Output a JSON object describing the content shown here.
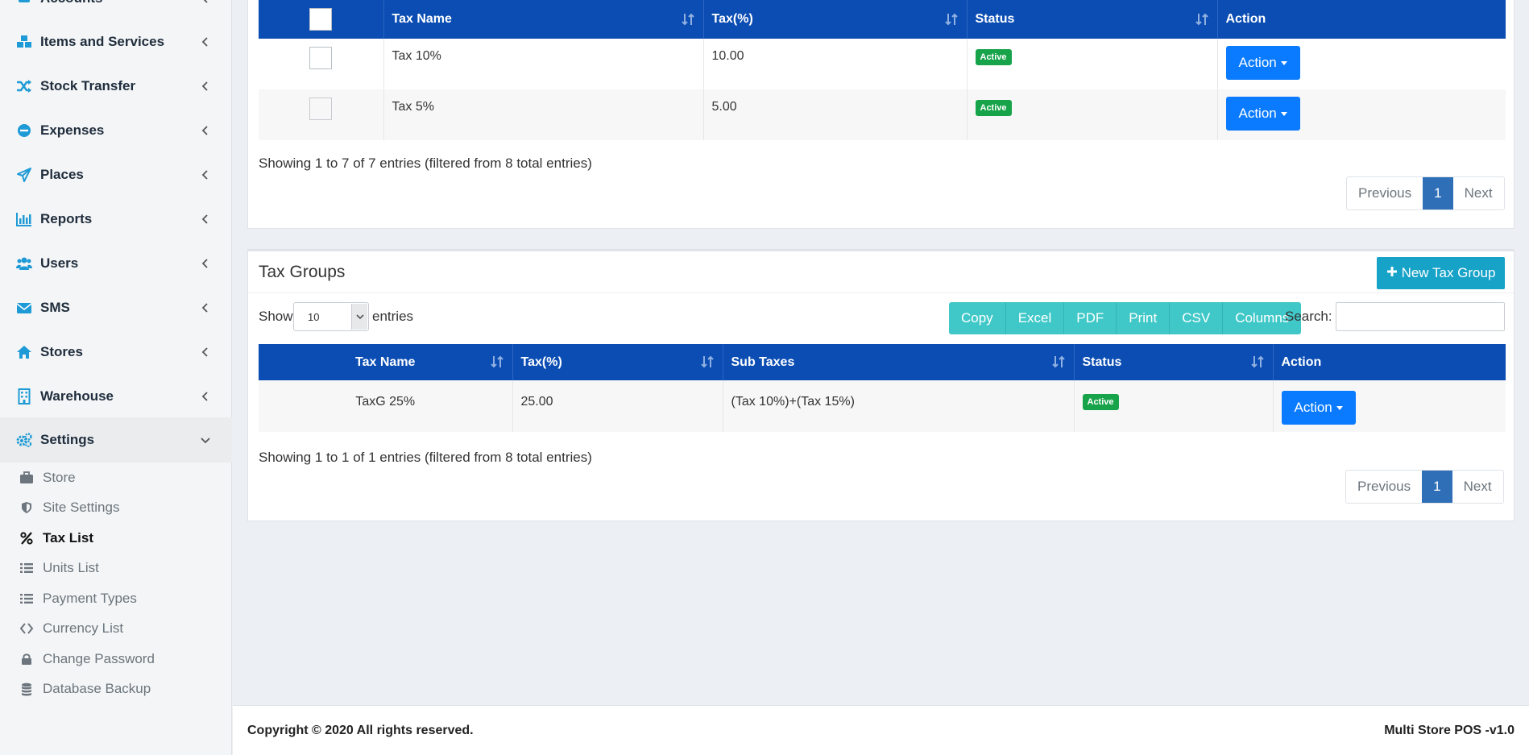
{
  "sidebar": {
    "partial_top_label": "Accounts",
    "items": [
      {
        "label": "Items and Services",
        "icon": "cubes-icon"
      },
      {
        "label": "Stock Transfer",
        "icon": "shuffle-icon"
      },
      {
        "label": "Expenses",
        "icon": "minus-circle-icon"
      },
      {
        "label": "Places",
        "icon": "paper-plane-icon"
      },
      {
        "label": "Reports",
        "icon": "bar-chart-icon"
      },
      {
        "label": "Users",
        "icon": "users-icon"
      },
      {
        "label": "SMS",
        "icon": "envelope-icon"
      },
      {
        "label": "Stores",
        "icon": "home-icon"
      },
      {
        "label": "Warehouse",
        "icon": "building-icon"
      },
      {
        "label": "Settings",
        "icon": "cogs-icon"
      }
    ],
    "settings_sub": [
      {
        "label": "Store",
        "icon": "briefcase-icon"
      },
      {
        "label": "Site Settings",
        "icon": "shield-icon"
      },
      {
        "label": "Tax List",
        "icon": "percent-icon"
      },
      {
        "label": "Units List",
        "icon": "list-icon"
      },
      {
        "label": "Payment Types",
        "icon": "list-icon"
      },
      {
        "label": "Currency List",
        "icon": "exchange-icon"
      },
      {
        "label": "Change Password",
        "icon": "lock-icon"
      },
      {
        "label": "Database Backup",
        "icon": "database-icon"
      }
    ]
  },
  "tax_table": {
    "headers": {
      "name": "Tax Name",
      "tax": "Tax(%)",
      "status": "Status",
      "action": "Action"
    },
    "rows": [
      {
        "name": "Tax 10%",
        "tax": "10.00",
        "status": "Active",
        "action": "Action"
      },
      {
        "name": "Tax 5%",
        "tax": "5.00",
        "status": "Active",
        "action": "Action"
      }
    ],
    "info": "Showing 1 to 7 of 7 entries (filtered from 8 total entries)",
    "pager": {
      "prev": "Previous",
      "page": "1",
      "next": "Next"
    }
  },
  "tax_groups": {
    "title": "Tax Groups",
    "new_button": "New Tax Group",
    "show_label": "Show",
    "show_value": "10",
    "entries_label": "entries",
    "export_buttons": [
      "Copy",
      "Excel",
      "PDF",
      "Print",
      "CSV",
      "Columns"
    ],
    "search_label": "Search:",
    "search_value": "",
    "headers": {
      "name": "Tax Name",
      "tax": "Tax(%)",
      "sub": "Sub Taxes",
      "status": "Status",
      "action": "Action"
    },
    "rows": [
      {
        "name": "TaxG 25%",
        "tax": "25.00",
        "sub": "(Tax 10%)+(Tax 15%)",
        "status": "Active",
        "action": "Action"
      }
    ],
    "info": "Showing 1 to 1 of 1 entries (filtered from 8 total entries)",
    "pager": {
      "prev": "Previous",
      "page": "1",
      "next": "Next"
    }
  },
  "footer": {
    "copyright": "Copyright © 2020 All rights reserved.",
    "version": "Multi Store POS -v1.0"
  },
  "colors": {
    "header_blue": "#0b4db3",
    "accent_teal": "#40c8c8",
    "action_blue": "#0a7bff",
    "active_green": "#17a34a",
    "icon_blue": "#1e9ad6"
  }
}
